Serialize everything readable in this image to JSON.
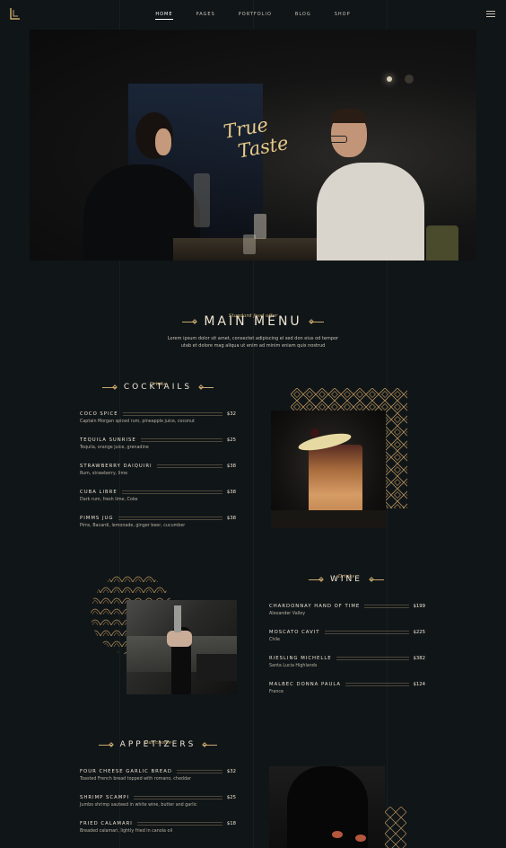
{
  "nav": {
    "items": [
      "HOME",
      "PAGES",
      "PORTFOLIO",
      "BLOG",
      "SHOP"
    ]
  },
  "hero": {
    "script_line1": "True",
    "script_line2": "Taste"
  },
  "main_menu": {
    "eyebrow": "Standard food offer",
    "title": "MAIN MENU",
    "intro_line1": "Lorem ipsum dolor sit amet, consectet adipiscing el sed don eius od tempor",
    "intro_line2": "utab et dolore mag aliqua ut enim ad minim eniam quis nostrud"
  },
  "cocktails": {
    "eyebrow": "Drinks",
    "title": "COCKTAILS",
    "items": [
      {
        "name": "COCO SPICE",
        "price": "$32",
        "desc": "Captain Morgan spiced rum, pineapple juice, coconut"
      },
      {
        "name": "TEQUILA SUNRISE",
        "price": "$25",
        "desc": "Tequila, orange juice, grenadine"
      },
      {
        "name": "STRAWBERRY DAIQUIRI",
        "price": "$38",
        "desc": "Rum, strawberry, lime"
      },
      {
        "name": "CUBA LIBRE",
        "price": "$38",
        "desc": "Dark rum, fresh lime, Coke"
      },
      {
        "name": "PIMMS JUG",
        "price": "$38",
        "desc": "Pims, Bacardi, lemonade, ginger beer, cucumber"
      }
    ]
  },
  "wine": {
    "eyebrow": "Drinks",
    "title": "WINE",
    "items": [
      {
        "name": "CHARDONNAY HAND OF TIME",
        "price": "$199",
        "desc": "Alexander Valley"
      },
      {
        "name": "MOSCATO CAVIT",
        "price": "$225",
        "desc": "Chile"
      },
      {
        "name": "RIESLING MICHELLE",
        "price": "$382",
        "desc": "Santa Lucia Highlands"
      },
      {
        "name": "MALBEC DONNA PAULA",
        "price": "$124",
        "desc": "France"
      }
    ]
  },
  "appetizers": {
    "eyebrow": "Our choice",
    "title": "APPETIZERS",
    "items": [
      {
        "name": "FOUR CHEESE GARLIC BREAD",
        "price": "$32",
        "desc": "Toasted French bread topped with romano, cheddar"
      },
      {
        "name": "SHRIMP SCAMPI",
        "price": "$25",
        "desc": "Jumbo shrimp sauteed in white wine, butter and garlic"
      },
      {
        "name": "FRIED CALAMARI",
        "price": "$18",
        "desc": "Breaded calamari, lightly fried in canola oil"
      }
    ]
  },
  "colors": {
    "background": "#101518",
    "gold": "#c8a86c",
    "text": "#efe6d3"
  }
}
